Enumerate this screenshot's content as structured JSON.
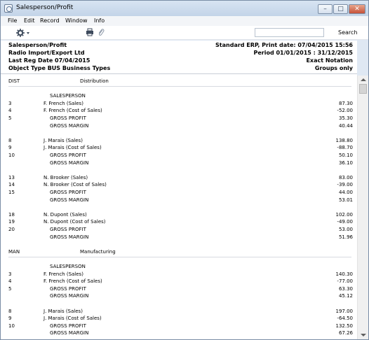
{
  "window": {
    "title": "Salesperson/Profit"
  },
  "menu": [
    "File",
    "Edit",
    "Record",
    "Window",
    "Info"
  ],
  "toolbar": {
    "search_label": "Search",
    "search_value": ""
  },
  "report_header": {
    "left": [
      "Salesperson/Profit",
      "Radio Import/Export Ltd",
      "Last Reg Date  07/04/2015",
      "Object Type  BUS  Business Types"
    ],
    "right": [
      "Standard ERP, Print date: 07/04/2015 15:56",
      "Period  01/01/2015 : 31/12/2015",
      "Exact Notation",
      "Groups only"
    ]
  },
  "sections": [
    {
      "code": "DIST",
      "name": "Distribution",
      "heading": "SALESPERSON",
      "groups": [
        {
          "rows": [
            {
              "code": "3",
              "label": "F. French (Sales)",
              "value": "87.30"
            },
            {
              "code": "4",
              "label": "F. French (Cost of Sales)",
              "value": "-52.00"
            },
            {
              "code": "5",
              "label": "GROSS PROFIT",
              "value": "35.30"
            },
            {
              "code": "",
              "label": "GROSS MARGIN",
              "value": "40.44"
            }
          ]
        },
        {
          "rows": [
            {
              "code": "8",
              "label": "J. Marais (Sales)",
              "value": "138.80"
            },
            {
              "code": "9",
              "label": "J. Marais (Cost of Sales)",
              "value": "-88.70"
            },
            {
              "code": "10",
              "label": "GROSS PROFIT",
              "value": "50.10"
            },
            {
              "code": "",
              "label": "GROSS MARGIN",
              "value": "36.10"
            }
          ]
        },
        {
          "rows": [
            {
              "code": "13",
              "label": "N. Brooker (Sales)",
              "value": "83.00"
            },
            {
              "code": "14",
              "label": "N. Brooker (Cost of Sales)",
              "value": "-39.00"
            },
            {
              "code": "15",
              "label": "GROSS PROFIT",
              "value": "44.00"
            },
            {
              "code": "",
              "label": "GROSS MARGIN",
              "value": "53.01"
            }
          ]
        },
        {
          "rows": [
            {
              "code": "18",
              "label": "N. Dupont (Sales)",
              "value": "102.00"
            },
            {
              "code": "19",
              "label": "N. Dupont (Cost of Sales)",
              "value": "-49.00"
            },
            {
              "code": "20",
              "label": "GROSS PROFIT",
              "value": "53.00"
            },
            {
              "code": "",
              "label": "GROSS MARGIN",
              "value": "51.96"
            }
          ]
        }
      ]
    },
    {
      "code": "MAN",
      "name": "Manufacturing",
      "heading": "SALESPERSON",
      "groups": [
        {
          "rows": [
            {
              "code": "3",
              "label": "F. French (Sales)",
              "value": "140.30"
            },
            {
              "code": "4",
              "label": "F. French (Cost of Sales)",
              "value": "-77.00"
            },
            {
              "code": "5",
              "label": "GROSS PROFIT",
              "value": "63.30"
            },
            {
              "code": "",
              "label": "GROSS MARGIN",
              "value": "45.12"
            }
          ]
        },
        {
          "rows": [
            {
              "code": "8",
              "label": "J. Marais (Sales)",
              "value": "197.00"
            },
            {
              "code": "9",
              "label": "J. Marais (Cost of Sales)",
              "value": "-64.50"
            },
            {
              "code": "10",
              "label": "GROSS PROFIT",
              "value": "132.50"
            },
            {
              "code": "",
              "label": "GROSS MARGIN",
              "value": "67.26"
            }
          ]
        }
      ]
    }
  ]
}
